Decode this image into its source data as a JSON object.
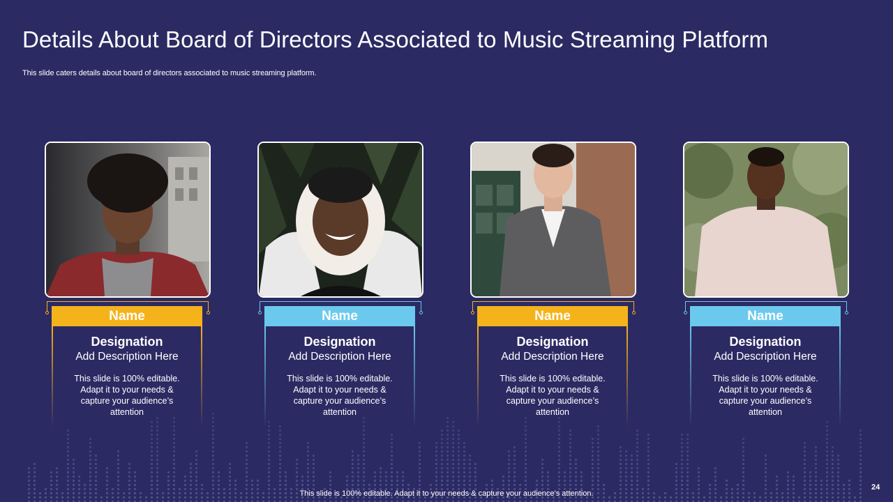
{
  "slide": {
    "title": "Details About Board of Directors Associated to Music Streaming Platform",
    "subtitle": "This slide caters details about board of directors associated to music streaming platform.",
    "footer": "This slide is 100% editable. Adapt it to your needs & capture your audience’s attention.",
    "page_number": "24"
  },
  "colors": {
    "background": "#2c2a63",
    "accent_yellow": "#f5b31b",
    "accent_blue": "#6cc9ee",
    "text": "#ffffff"
  },
  "cards": [
    {
      "name": "Name",
      "designation": "Designation",
      "add_description": "Add Description Here",
      "description": "This slide is 100% editable. Adapt it to your needs & capture your audience’s attention",
      "accent": "#f5b31b"
    },
    {
      "name": "Name",
      "designation": "Designation",
      "add_description": "Add Description Here",
      "description": "This slide is 100% editable. Adapt it to your needs & capture your audience’s attention",
      "accent": "#6cc9ee"
    },
    {
      "name": "Name",
      "designation": "Designation",
      "add_description": "Add Description Here",
      "description": "This slide is 100% editable. Adapt it to your needs & capture your audience’s attention",
      "accent": "#f5b31b"
    },
    {
      "name": "Name",
      "designation": "Designation",
      "add_description": "Add Description Here",
      "description": "This slide is 100% editable. Adapt it to your needs & capture your audience’s attention",
      "accent": "#6cc9ee"
    }
  ]
}
